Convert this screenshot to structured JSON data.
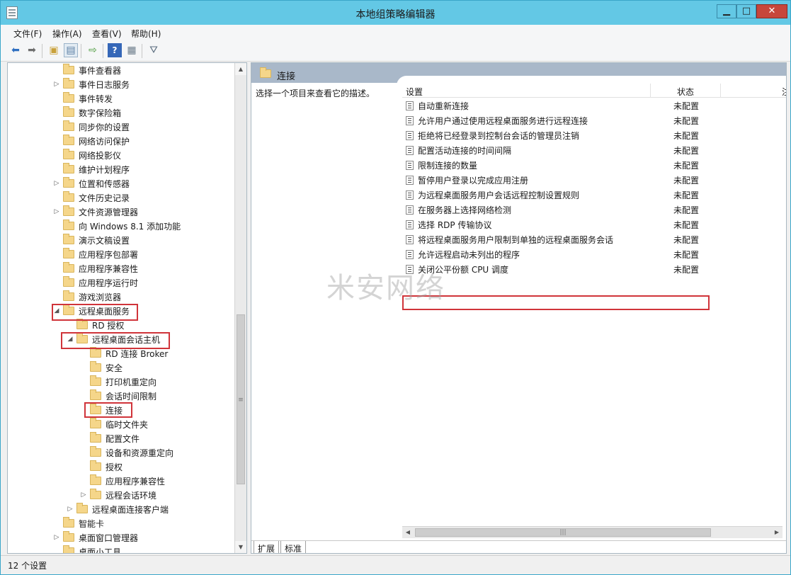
{
  "window": {
    "title": "本地组策略编辑器",
    "btn_min": "▁",
    "btn_max": "□",
    "btn_close": "✕"
  },
  "menu": [
    "文件(F)",
    "操作(A)",
    "查看(V)",
    "帮助(H)"
  ],
  "toolbar": {
    "icons": [
      "back-arrow-icon",
      "forward-arrow-icon",
      "up-folder-icon",
      "show-hide-tree-icon",
      "export-list-icon",
      "help-icon",
      "properties-pane-icon",
      "filter-icon"
    ]
  },
  "tree": {
    "items": [
      {
        "label": "事件查看器",
        "expander": ""
      },
      {
        "label": "事件日志服务",
        "expander": "▷"
      },
      {
        "label": "事件转发",
        "expander": ""
      },
      {
        "label": "数字保险箱",
        "expander": ""
      },
      {
        "label": "同步你的设置",
        "expander": ""
      },
      {
        "label": "网络访问保护",
        "expander": ""
      },
      {
        "label": "网络投影仪",
        "expander": ""
      },
      {
        "label": "维护计划程序",
        "expander": ""
      },
      {
        "label": "位置和传感器",
        "expander": "▷"
      },
      {
        "label": "文件历史记录",
        "expander": ""
      },
      {
        "label": "文件资源管理器",
        "expander": "▷"
      },
      {
        "label": "向 Windows 8.1 添加功能",
        "expander": ""
      },
      {
        "label": "演示文稿设置",
        "expander": ""
      },
      {
        "label": "应用程序包部署",
        "expander": ""
      },
      {
        "label": "应用程序兼容性",
        "expander": ""
      },
      {
        "label": "应用程序运行时",
        "expander": ""
      },
      {
        "label": "游戏浏览器",
        "expander": ""
      },
      {
        "label": "远程桌面服务",
        "expander": "◢"
      },
      {
        "label": "RD 授权",
        "expander": ""
      },
      {
        "label": "远程桌面会话主机",
        "expander": "◢"
      },
      {
        "label": "RD 连接 Broker",
        "expander": ""
      },
      {
        "label": "安全",
        "expander": ""
      },
      {
        "label": "打印机重定向",
        "expander": ""
      },
      {
        "label": "会话时间限制",
        "expander": ""
      },
      {
        "label": "连接",
        "expander": ""
      },
      {
        "label": "临时文件夹",
        "expander": ""
      },
      {
        "label": "配置文件",
        "expander": ""
      },
      {
        "label": "设备和资源重定向",
        "expander": ""
      },
      {
        "label": "授权",
        "expander": ""
      },
      {
        "label": "应用程序兼容性",
        "expander": ""
      },
      {
        "label": "远程会话环境",
        "expander": "▷"
      },
      {
        "label": "远程桌面连接客户端",
        "expander": "▷"
      },
      {
        "label": "智能卡",
        "expander": ""
      },
      {
        "label": "桌面窗口管理器",
        "expander": "▷"
      },
      {
        "label": "桌面小工具",
        "expander": ""
      }
    ]
  },
  "right": {
    "title": "连接",
    "description": "选择一个项目来查看它的描述。",
    "col_setting": "设置",
    "col_status": "状态",
    "col_extra": "注",
    "rows": [
      {
        "name": "自动重新连接",
        "status": "未配置"
      },
      {
        "name": "允许用户通过使用远程桌面服务进行远程连接",
        "status": "未配置"
      },
      {
        "name": "拒绝将已经登录到控制台会话的管理员注销",
        "status": "未配置"
      },
      {
        "name": "配置活动连接的时间间隔",
        "status": "未配置"
      },
      {
        "name": "限制连接的数量",
        "status": "未配置"
      },
      {
        "name": "暂停用户登录以完成应用注册",
        "status": "未配置"
      },
      {
        "name": "为远程桌面服务用户会话远程控制设置规则",
        "status": "未配置"
      },
      {
        "name": "在服务器上选择网络检测",
        "status": "未配置"
      },
      {
        "name": "选择 RDP 传输协议",
        "status": "未配置"
      },
      {
        "name": "将远程桌面服务用户限制到单独的远程桌面服务会话",
        "status": "未配置"
      },
      {
        "name": "允许远程启动未列出的程序",
        "status": "未配置"
      },
      {
        "name": "关闭公平份额 CPU 调度",
        "status": "未配置"
      }
    ],
    "tab_extended": "扩展",
    "tab_standard": "标准",
    "watermark": "米安网络"
  },
  "status": {
    "text": "12 个设置"
  },
  "colors": {
    "titlebar": "#63c8e5",
    "highlight_border": "#d0343a",
    "pane_header": "#a9b8c9"
  }
}
